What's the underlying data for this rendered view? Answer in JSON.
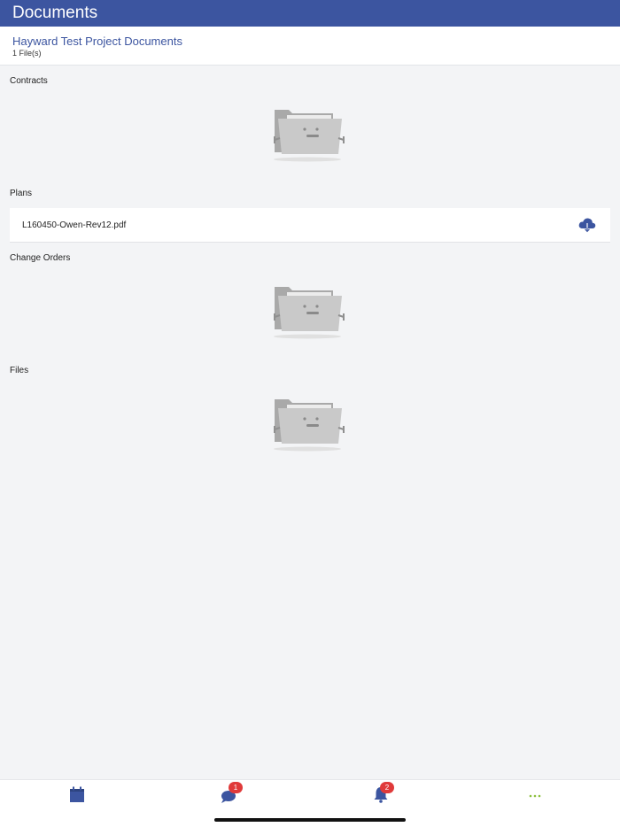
{
  "app": {
    "title": "Documents"
  },
  "project": {
    "title": "Hayward Test Project Documents",
    "file_count": "1 File(s)"
  },
  "sections": {
    "contracts": {
      "label": "Contracts"
    },
    "plans": {
      "label": "Plans",
      "files": [
        {
          "name": "L160450-Owen-Rev12.pdf"
        }
      ]
    },
    "change_orders": {
      "label": "Change Orders"
    },
    "files": {
      "label": "Files"
    }
  },
  "tabbar": {
    "calendar": {
      "icon": "calendar-icon"
    },
    "messages": {
      "icon": "chat-icon",
      "badge": "1"
    },
    "notifications": {
      "icon": "bell-icon",
      "badge": "2"
    },
    "more": {
      "icon": "more-icon"
    }
  },
  "colors": {
    "accent": "#3c55a0",
    "badge": "#e03a3a",
    "more": "#8cbf3c",
    "background": "#f3f4f6"
  }
}
